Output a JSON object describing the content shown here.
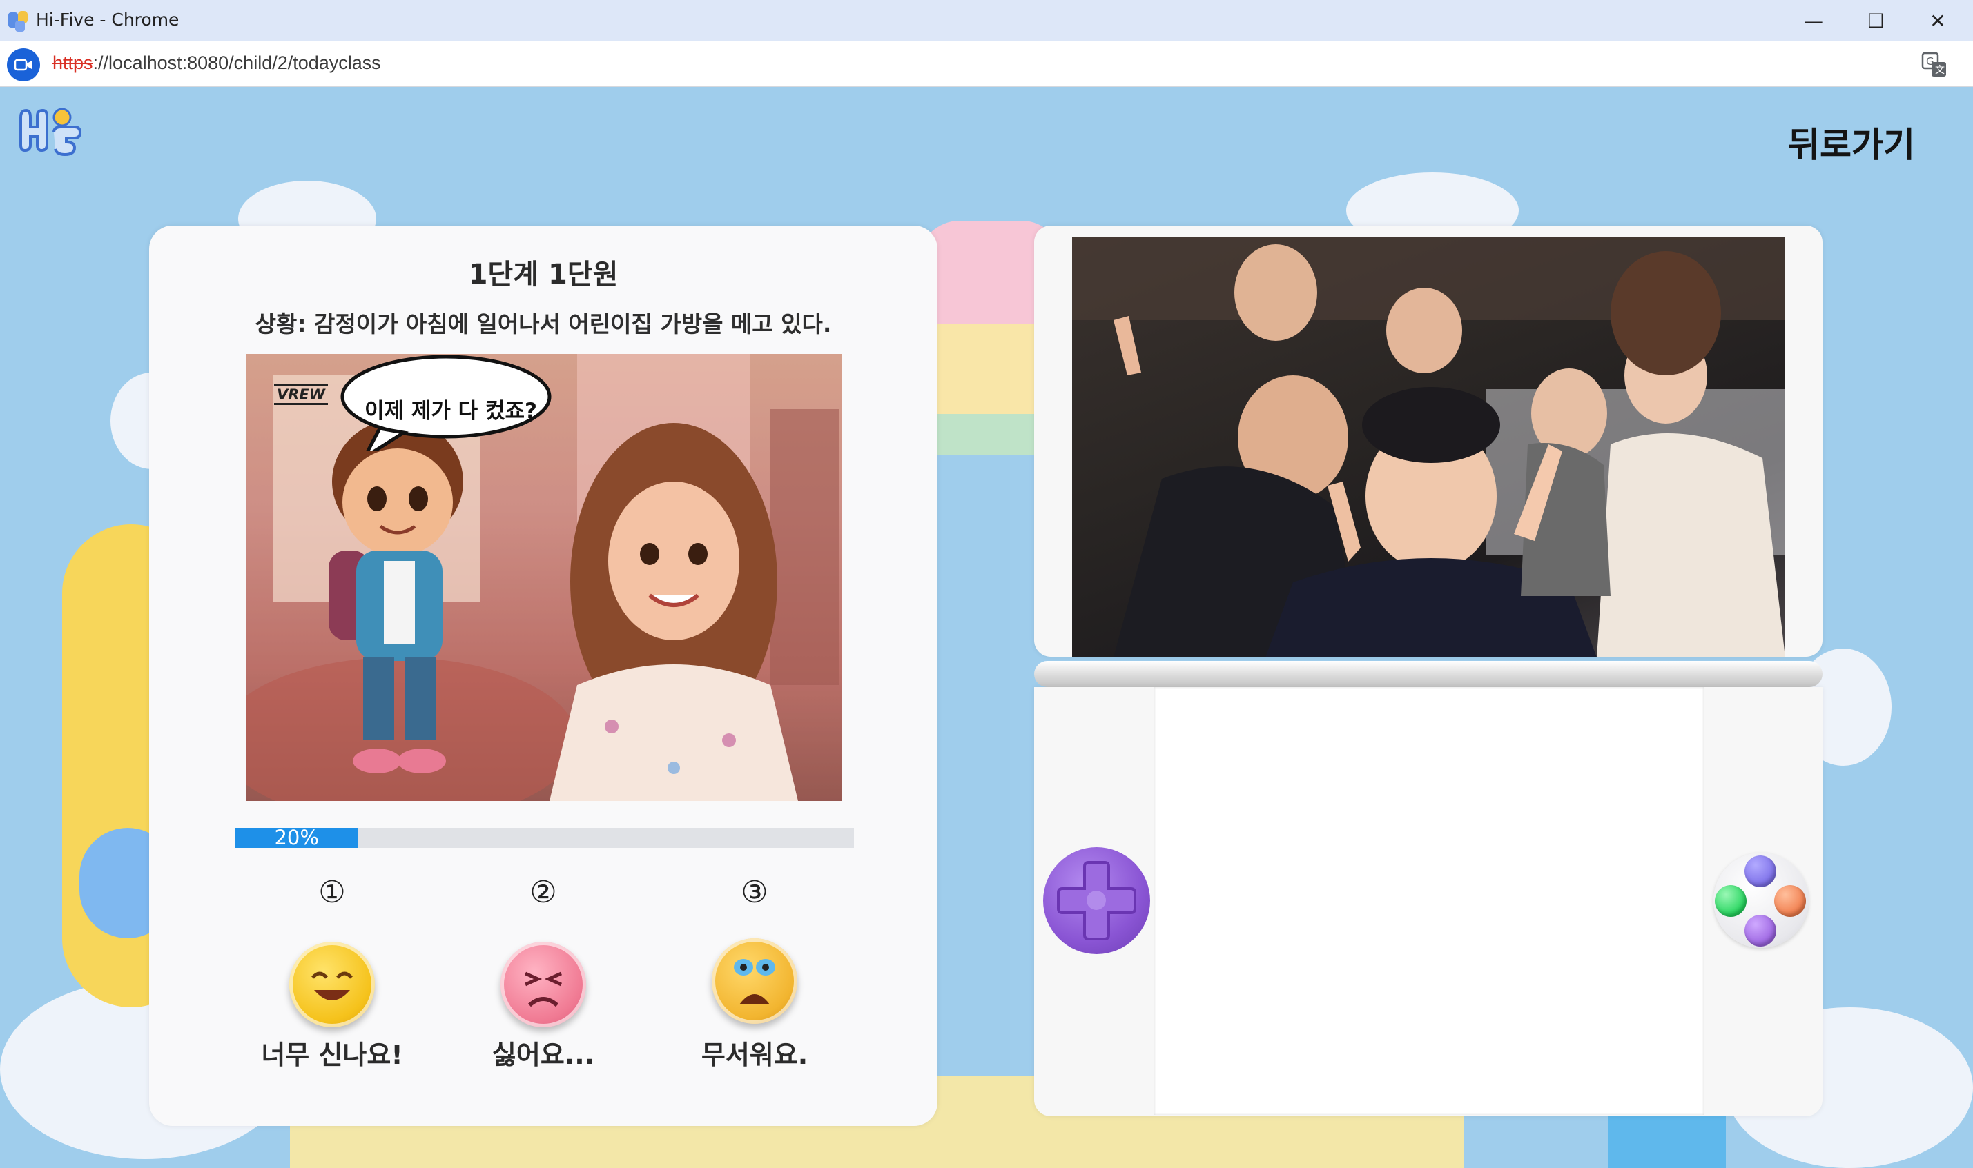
{
  "window": {
    "title": "Hi-Five - Chrome",
    "minimize_glyph": "—",
    "maximize_glyph": "☐",
    "close_glyph": "✕"
  },
  "address_bar": {
    "scheme": "https",
    "rest": "://localhost:8080/child/2/todayclass"
  },
  "header": {
    "back_label": "뒤로가기"
  },
  "lesson": {
    "title": "1단계 1단원",
    "situation": "상황: 감정이가 아침에 일어나서 어린이집 가방을 메고 있다.",
    "speech_bubble": "이제 제가 다 컸죠?",
    "watermark": "VREW",
    "progress_percent": 20,
    "progress_label": "20%"
  },
  "choices": [
    {
      "number": "①",
      "label": "너무 신나요!",
      "emotion": "happy",
      "color": "#f5c21b"
    },
    {
      "number": "②",
      "label": "싫어요...",
      "emotion": "dislike",
      "color": "#f07a93"
    },
    {
      "number": "③",
      "label": "무서워요.",
      "emotion": "scared",
      "color": "#f2b530"
    }
  ],
  "console": {
    "dpad_icon": "dpad-icon",
    "buttons": [
      {
        "name": "top",
        "color": "#7b6ee8"
      },
      {
        "name": "left",
        "color": "#23d45c"
      },
      {
        "name": "right",
        "color": "#f07b4a"
      },
      {
        "name": "bottom",
        "color": "#9a62e0"
      }
    ]
  },
  "colors": {
    "background": "#9fcdec",
    "progress": "#1e90e8",
    "dpad": "#8a55d4"
  }
}
